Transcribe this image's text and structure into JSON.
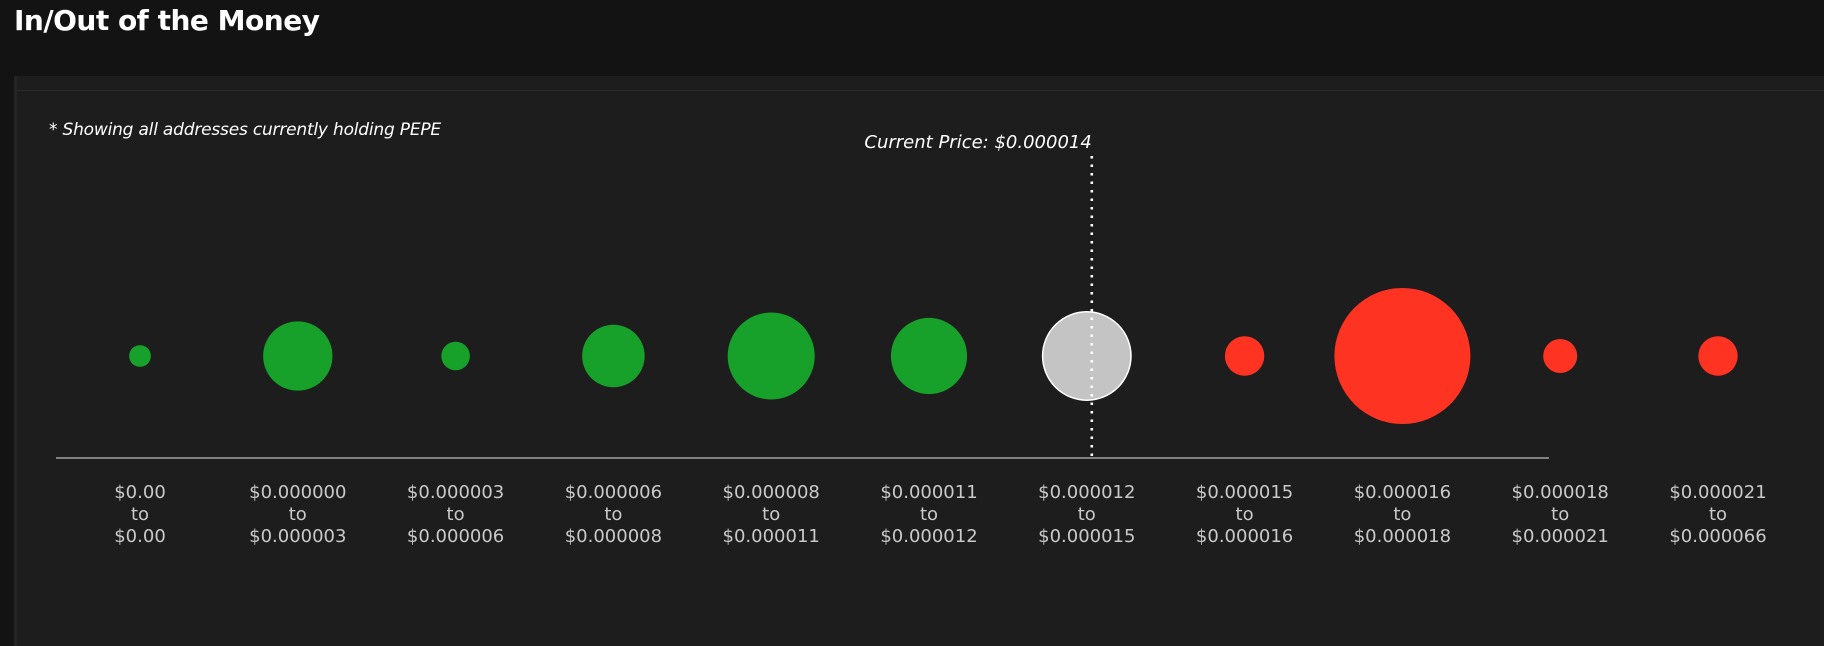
{
  "page": {
    "title": "In/Out of the Money",
    "note": "* Showing all addresses currently holding PEPE"
  },
  "chart_data": {
    "type": "bubble",
    "current_price_label": "Current Price: $0.000014",
    "current_price_bucket_index": 6,
    "buckets": [
      {
        "from": "$0.00",
        "joiner": "to",
        "to": "$0.00",
        "status": "in",
        "relative_size": 0.16
      },
      {
        "from": "$0.000000",
        "joiner": "to",
        "to": "$0.000003",
        "status": "in",
        "relative_size": 0.51
      },
      {
        "from": "$0.000003",
        "joiner": "to",
        "to": "$0.000006",
        "status": "in",
        "relative_size": 0.21
      },
      {
        "from": "$0.000006",
        "joiner": "to",
        "to": "$0.000008",
        "status": "in",
        "relative_size": 0.46
      },
      {
        "from": "$0.000008",
        "joiner": "to",
        "to": "$0.000011",
        "status": "in",
        "relative_size": 0.64
      },
      {
        "from": "$0.000011",
        "joiner": "to",
        "to": "$0.000012",
        "status": "in",
        "relative_size": 0.56
      },
      {
        "from": "$0.000012",
        "joiner": "to",
        "to": "$0.000015",
        "status": "at",
        "relative_size": 0.65
      },
      {
        "from": "$0.000015",
        "joiner": "to",
        "to": "$0.000016",
        "status": "out",
        "relative_size": 0.29
      },
      {
        "from": "$0.000016",
        "joiner": "to",
        "to": "$0.000018",
        "status": "out",
        "relative_size": 1.0
      },
      {
        "from": "$0.000018",
        "joiner": "to",
        "to": "$0.000021",
        "status": "out",
        "relative_size": 0.25
      },
      {
        "from": "$0.000021",
        "joiner": "to",
        "to": "$0.000066",
        "status": "out",
        "relative_size": 0.29
      }
    ],
    "colors": {
      "in": "#17a12a",
      "at": "#c4c4c4",
      "out": "#ff3322"
    }
  }
}
